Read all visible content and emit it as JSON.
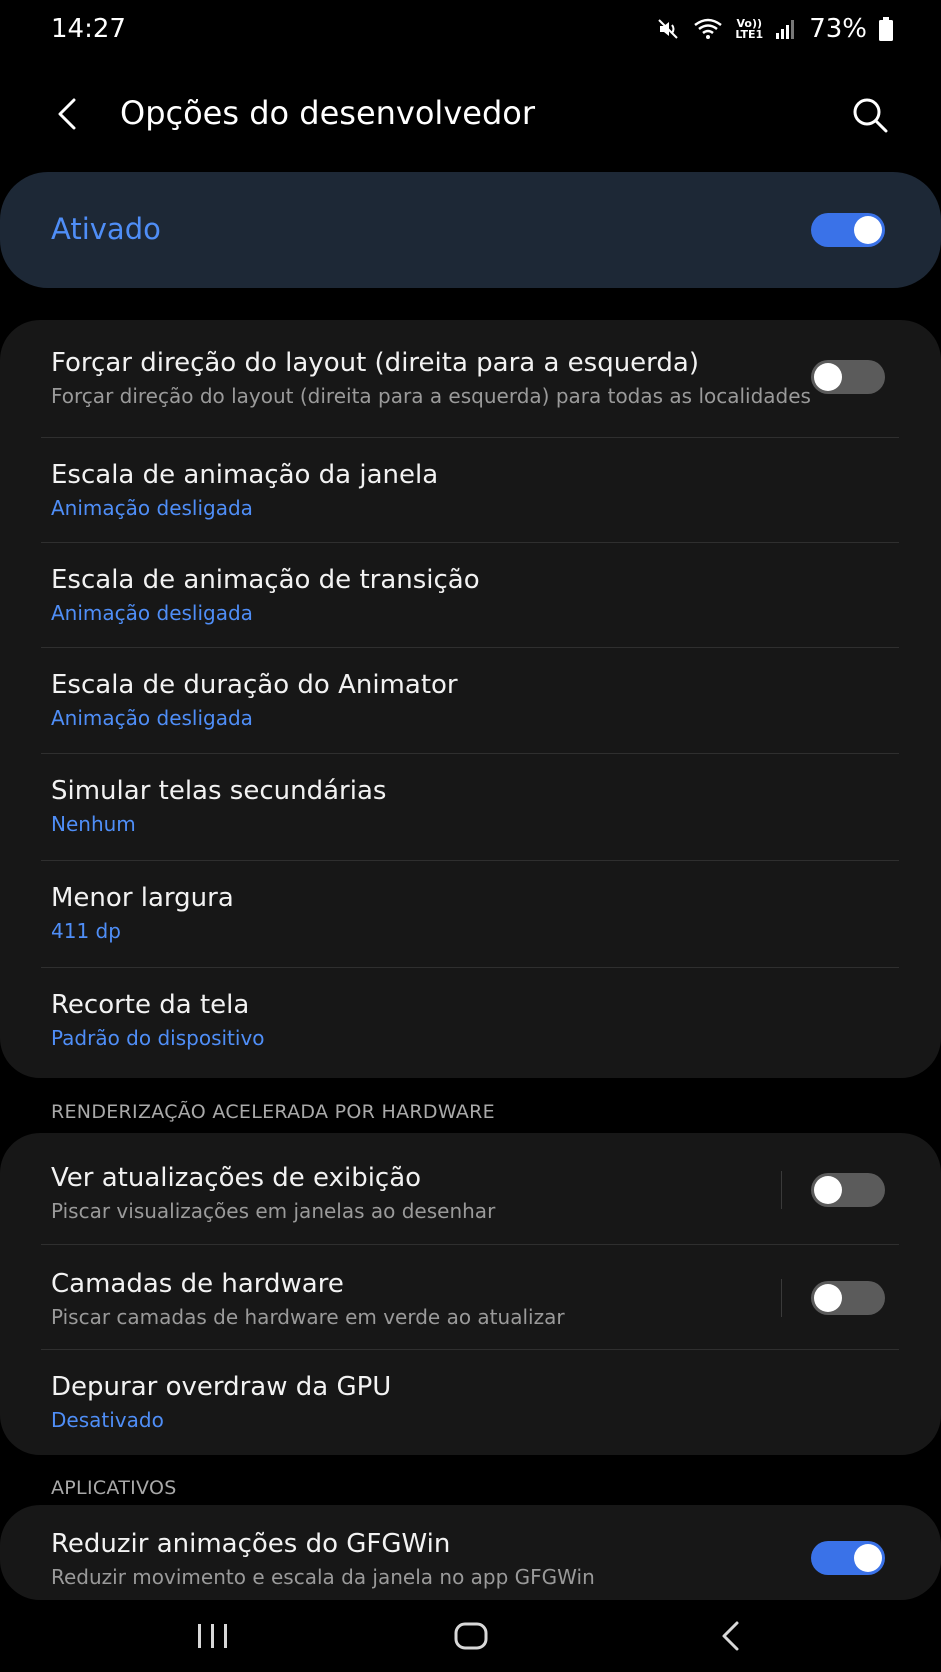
{
  "status_bar": {
    "time": "14:27",
    "battery_percent": "73%",
    "volte_top": "Vo))",
    "volte_bottom": "LTE1",
    "icons": [
      "mute-icon",
      "wifi-icon",
      "volte-icon",
      "signal-icon",
      "battery-icon"
    ]
  },
  "header": {
    "title": "Opções do desenvolvedor",
    "back_icon": "back-arrow-icon",
    "search_icon": "search-icon"
  },
  "master": {
    "label": "Ativado",
    "toggle_on": true
  },
  "group1": {
    "rows": [
      {
        "title": "Forçar direção do layout (direita para a esquerda)",
        "subtitle": "Forçar direção do layout (direita para a esquerda) para todas as localidades",
        "toggle_on": false
      },
      {
        "title": "Escala de animação da janela",
        "subtitle": "Animação desligada"
      },
      {
        "title": "Escala de animação de transição",
        "subtitle": "Animação desligada"
      },
      {
        "title": "Escala de duração do Animator",
        "subtitle": "Animação desligada"
      },
      {
        "title": "Simular telas secundárias",
        "subtitle": "Nenhum"
      },
      {
        "title": "Menor largura",
        "subtitle": "411 dp"
      },
      {
        "title": "Recorte da tela",
        "subtitle": "Padrão do dispositivo"
      }
    ]
  },
  "section_hardware": {
    "header": "RENDERIZAÇÃO ACELERADA POR HARDWARE",
    "rows": [
      {
        "title": "Ver atualizações de exibição",
        "subtitle": "Piscar visualizações em janelas ao desenhar",
        "toggle_on": false
      },
      {
        "title": "Camadas de hardware",
        "subtitle": "Piscar camadas de hardware em verde ao atualizar",
        "toggle_on": false
      },
      {
        "title": "Depurar overdraw da GPU",
        "subtitle": "Desativado"
      }
    ]
  },
  "section_apps": {
    "header": "APLICATIVOS",
    "rows": [
      {
        "title": "Reduzir animações do GFGWin",
        "subtitle": "Reduzir movimento e escala da janela no app GFGWin",
        "toggle_on": true
      }
    ]
  },
  "nav_bar": {
    "icons": [
      "recent-apps-icon",
      "home-icon",
      "nav-back-icon"
    ]
  },
  "colors": {
    "accent": "#4f8ef7",
    "toggle_on": "#3a72e8",
    "card_bg": "#171717",
    "master_bg": "#1d2836",
    "background": "#000000"
  }
}
